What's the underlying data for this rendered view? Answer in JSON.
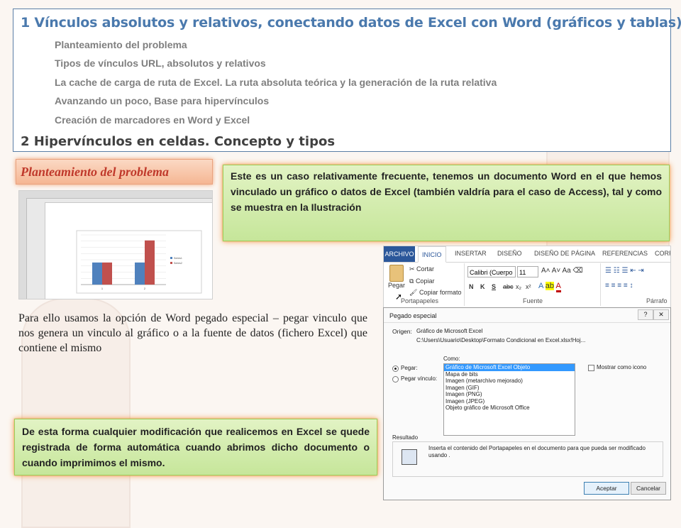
{
  "toc": {
    "section1": "1 Vínculos absolutos y relativos, conectando datos de Excel con Word (gráficos y tablas)",
    "items": [
      "Planteamiento del problema",
      "Tipos de vínculos URL, absolutos y relativos",
      "La cache de carga de ruta de Excel. La ruta absoluta teórica y la generación de la ruta relativa",
      "Avanzando un poco, Base para hipervínculos",
      "Creación de marcadores en Word y Excel"
    ],
    "section2": "2 Hipervínculos en celdas. Concepto y tipos"
  },
  "heading": "Planteamiento del problema",
  "callout_top": "Este es un caso relativamente frecuente, tenemos un documento Word en el que hemos vinculado un gráfico o datos de Excel (también valdría para el caso de Access), tal y como se muestra en la Ilustración",
  "paragraph": "Para ello usamos la opción de Word pegado especial – pegar vinculo que nos genera un vinculo al gráfico o a la fuente de datos (fichero Excel) que contiene el mismo",
  "callout_bottom": "De esta forma cualquier modificación que realicemos en Excel se quede registrada de forma automática cuando abrimos dicho documento o cuando imprimimos el mismo.",
  "doc_chart": {
    "chart_data": {
      "type": "bar",
      "categories": [
        "1",
        "2"
      ],
      "series": [
        {
          "name": "Series1",
          "values": [
            2,
            2
          ],
          "color": "#4f81bd"
        },
        {
          "name": "Series2",
          "values": [
            2,
            4
          ],
          "color": "#c0504d"
        }
      ],
      "ylim": [
        0,
        4.5
      ]
    }
  },
  "ribbon": {
    "tabs": [
      "ARCHIVO",
      "INICIO",
      "INSERTAR",
      "DISEÑO",
      "DISEÑO DE PÁGINA",
      "REFERENCIAS",
      "CORR"
    ],
    "paste": "Pegar",
    "cut": "Cortar",
    "copy": "Copiar",
    "format_painter": "Copiar formato",
    "font_name": "Calibri (Cuerpo",
    "font_size": "11",
    "groups": [
      "Portapapeles",
      "Fuente",
      "Párrafo"
    ],
    "font_buttons": [
      "N",
      "K",
      "S",
      "abc",
      "x₂",
      "x²"
    ]
  },
  "dialog": {
    "title": "Pegado especial",
    "origin_label": "Origen:",
    "origin_value": "Gráfico de Microsoft Excel",
    "origin_path": "C:\\Users\\Usuario\\Desktop\\Formato Condicional en Excel.xlsx!Hoj...",
    "como_label": "Como:",
    "paste_label": "Pegar:",
    "paste_link_label": "Pegar vínculo:",
    "list": [
      "Gráfico de Microsoft Excel Objeto",
      "Mapa de bits",
      "Imagen (metarchivo mejorado)",
      "Imagen (GIF)",
      "Imagen (PNG)",
      "Imagen (JPEG)",
      "Objeto gráfico de Microsoft Office"
    ],
    "show_icon": "Mostrar como icono",
    "result_label": "Resultado",
    "result_text": "Inserta el contenido del Portapapeles en el documento para que pueda ser modificado usando .",
    "accept": "Aceptar",
    "cancel": "Cancelar",
    "help_btn": "?",
    "close_btn": "✕"
  }
}
